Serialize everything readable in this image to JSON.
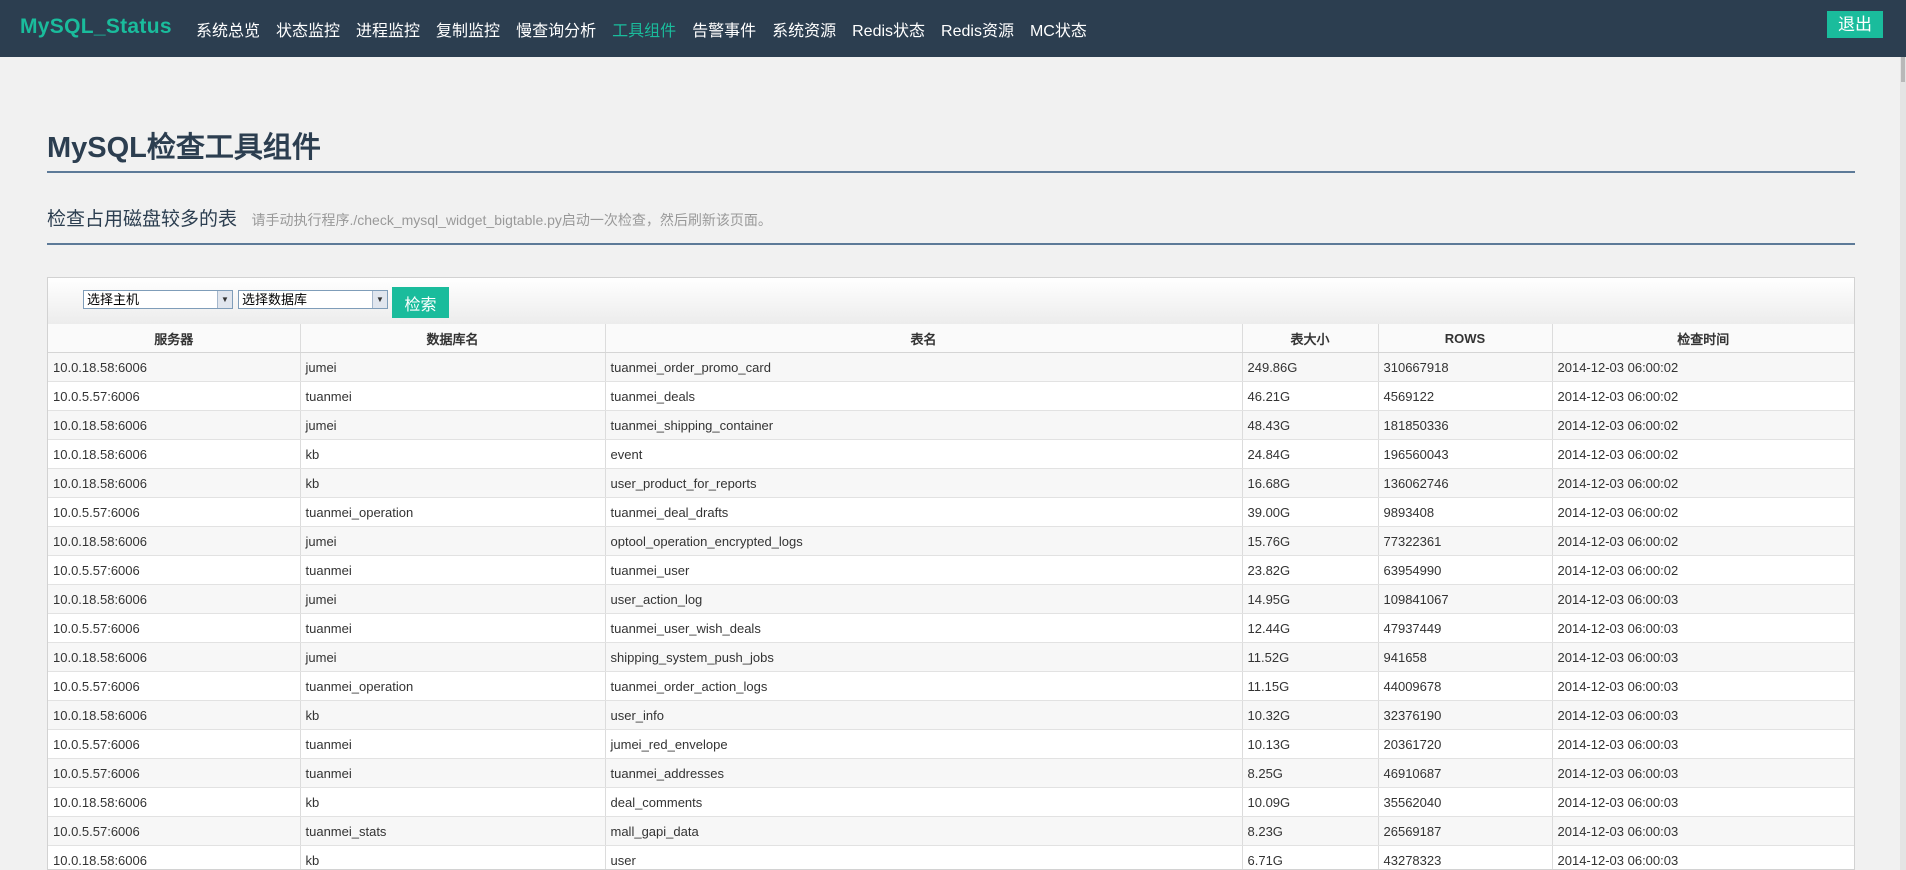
{
  "navbar": {
    "brand": "MySQL_Status",
    "items": [
      {
        "label": "系统总览"
      },
      {
        "label": "状态监控"
      },
      {
        "label": "进程监控"
      },
      {
        "label": "复制监控"
      },
      {
        "label": "慢查询分析"
      },
      {
        "label": "工具组件",
        "active": true
      },
      {
        "label": "告警事件"
      },
      {
        "label": "系统资源"
      },
      {
        "label": "Redis状态"
      },
      {
        "label": "Redis资源"
      },
      {
        "label": "MC状态"
      }
    ],
    "logout_label": "退出"
  },
  "page": {
    "title": "MySQL检查工具组件",
    "section_title": "检查占用磁盘较多的表",
    "section_hint": "请手动执行程序./check_mysql_widget_bigtable.py启动一次检查，然后刷新该页面。"
  },
  "filters": {
    "host_select": "选择主机",
    "db_select": "选择数据库",
    "search_label": "检索"
  },
  "table": {
    "headers": [
      "服务器",
      "数据库名",
      "表名",
      "表大小",
      "ROWS",
      "检查时间"
    ],
    "rows": [
      [
        "10.0.18.58:6006",
        "jumei",
        "tuanmei_order_promo_card",
        "249.86G",
        "310667918",
        "2014-12-03 06:00:02"
      ],
      [
        "10.0.5.57:6006",
        "tuanmei",
        "tuanmei_deals",
        "46.21G",
        "4569122",
        "2014-12-03 06:00:02"
      ],
      [
        "10.0.18.58:6006",
        "jumei",
        "tuanmei_shipping_container",
        "48.43G",
        "181850336",
        "2014-12-03 06:00:02"
      ],
      [
        "10.0.18.58:6006",
        "kb",
        "event",
        "24.84G",
        "196560043",
        "2014-12-03 06:00:02"
      ],
      [
        "10.0.18.58:6006",
        "kb",
        "user_product_for_reports",
        "16.68G",
        "136062746",
        "2014-12-03 06:00:02"
      ],
      [
        "10.0.5.57:6006",
        "tuanmei_operation",
        "tuanmei_deal_drafts",
        "39.00G",
        "9893408",
        "2014-12-03 06:00:02"
      ],
      [
        "10.0.18.58:6006",
        "jumei",
        "optool_operation_encrypted_logs",
        "15.76G",
        "77322361",
        "2014-12-03 06:00:02"
      ],
      [
        "10.0.5.57:6006",
        "tuanmei",
        "tuanmei_user",
        "23.82G",
        "63954990",
        "2014-12-03 06:00:02"
      ],
      [
        "10.0.18.58:6006",
        "jumei",
        "user_action_log",
        "14.95G",
        "109841067",
        "2014-12-03 06:00:03"
      ],
      [
        "10.0.5.57:6006",
        "tuanmei",
        "tuanmei_user_wish_deals",
        "12.44G",
        "47937449",
        "2014-12-03 06:00:03"
      ],
      [
        "10.0.18.58:6006",
        "jumei",
        "shipping_system_push_jobs",
        "11.52G",
        "941658",
        "2014-12-03 06:00:03"
      ],
      [
        "10.0.5.57:6006",
        "tuanmei_operation",
        "tuanmei_order_action_logs",
        "11.15G",
        "44009678",
        "2014-12-03 06:00:03"
      ],
      [
        "10.0.18.58:6006",
        "kb",
        "user_info",
        "10.32G",
        "32376190",
        "2014-12-03 06:00:03"
      ],
      [
        "10.0.5.57:6006",
        "tuanmei",
        "jumei_red_envelope",
        "10.13G",
        "20361720",
        "2014-12-03 06:00:03"
      ],
      [
        "10.0.5.57:6006",
        "tuanmei",
        "tuanmei_addresses",
        "8.25G",
        "46910687",
        "2014-12-03 06:00:03"
      ],
      [
        "10.0.18.58:6006",
        "kb",
        "deal_comments",
        "10.09G",
        "35562040",
        "2014-12-03 06:00:03"
      ],
      [
        "10.0.5.57:6006",
        "tuanmei_stats",
        "mall_gapi_data",
        "8.23G",
        "26569187",
        "2014-12-03 06:00:03"
      ],
      [
        "10.0.18.58:6006",
        "kb",
        "user",
        "6.71G",
        "43278323",
        "2014-12-03 06:00:03"
      ]
    ]
  },
  "colors": {
    "navbar_bg": "#2c3e50",
    "accent": "#1abc9c",
    "rule": "#5d7a98"
  }
}
